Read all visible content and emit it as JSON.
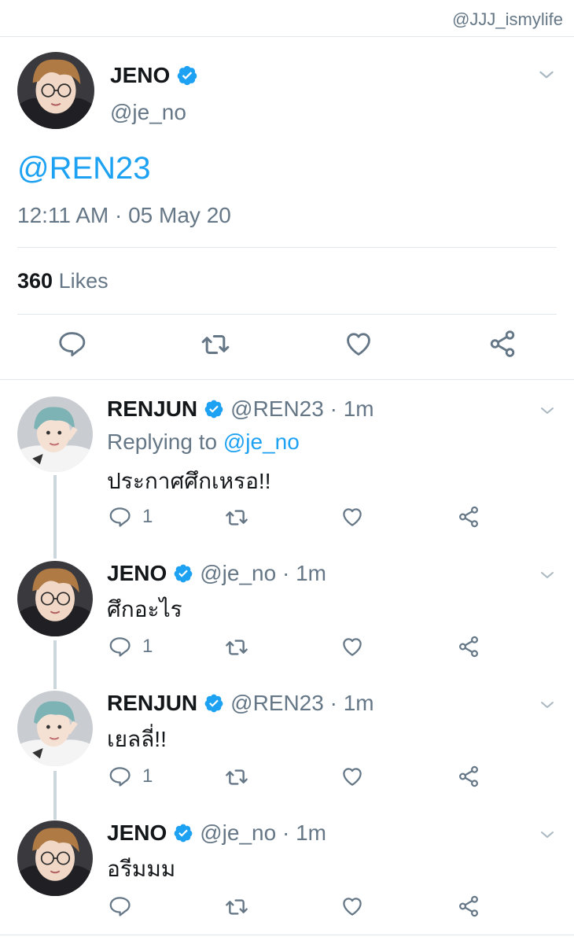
{
  "watermark": "@JJJ_ismylife",
  "main_tweet": {
    "name": "JENO",
    "handle": "@je_no",
    "text": "@REN23",
    "time": "12:11 AM · 05 May 20",
    "likes_count": "360",
    "likes_label": "Likes"
  },
  "replies": [
    {
      "name": "RENJUN",
      "handle": "@REN23 · 1m",
      "replying_prefix": "Replying to",
      "replying_to": "@je_no",
      "text": "ประกาศศึกเหรอ!!",
      "reply_count": "1"
    },
    {
      "name": "JENO",
      "handle": "@je_no · 1m",
      "text": "ศึกอะไร",
      "reply_count": "1"
    },
    {
      "name": "RENJUN",
      "handle": "@REN23 · 1m",
      "text": "เยลลี่!!",
      "reply_count": "1"
    },
    {
      "name": "JENO",
      "handle": "@je_no · 1m",
      "text": "อรีมมม",
      "reply_count": ""
    }
  ],
  "colors": {
    "accent": "#1da1f2",
    "secondary_text": "#657786",
    "divider": "#e1e8ed",
    "thread_line": "#ccd6dd"
  },
  "icons": [
    "verified-badge-icon",
    "chevron-down-icon",
    "reply-icon",
    "retweet-icon",
    "like-icon",
    "share-icon"
  ]
}
